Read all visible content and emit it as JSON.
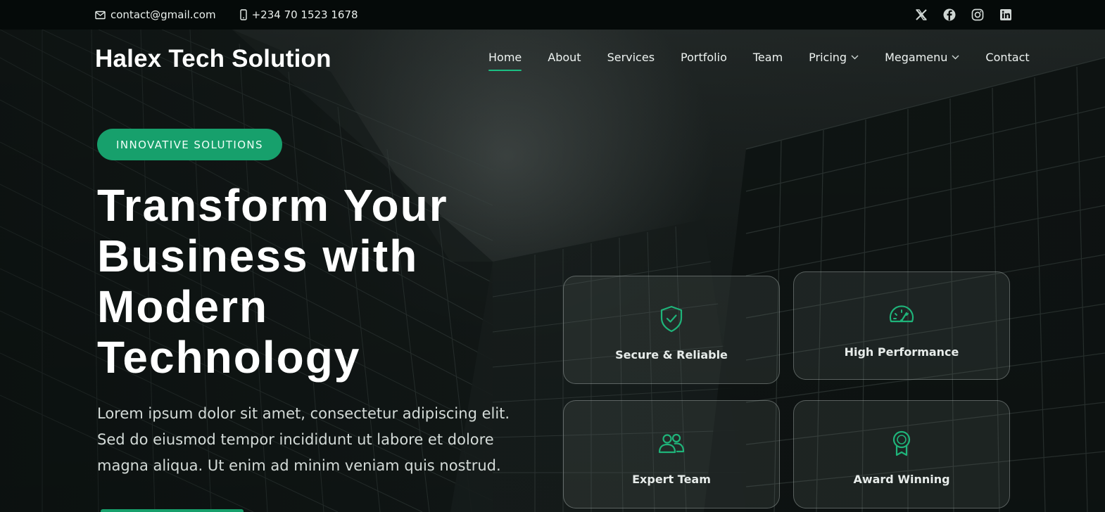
{
  "topbar": {
    "email": "contact@gmail.com",
    "phone": "+234 70 1523 1678",
    "email_icon": "envelope-icon",
    "phone_icon": "mobile-phone-icon",
    "socials": [
      "x-twitter-icon",
      "facebook-icon",
      "instagram-icon",
      "linkedin-icon"
    ]
  },
  "header": {
    "brand": "Halex Tech Solution",
    "nav": [
      {
        "label": "Home",
        "active": true
      },
      {
        "label": "About"
      },
      {
        "label": "Services"
      },
      {
        "label": "Portfolio"
      },
      {
        "label": "Team"
      },
      {
        "label": "Pricing",
        "dropdown": true
      },
      {
        "label": "Megamenu",
        "dropdown": true
      },
      {
        "label": "Contact"
      }
    ]
  },
  "hero": {
    "badge": "INNOVATIVE SOLUTIONS",
    "headline_lines": [
      "Transform Your",
      "Business with",
      "Modern",
      "Technology"
    ],
    "lead": "Lorem ipsum dolor sit amet, consectetur adipiscing elit. Sed do eiusmod tempor incididunt ut labore et dolore magna aliqua. Ut enim ad minim veniam quis nostrud."
  },
  "features": [
    {
      "title": "Secure & Reliable",
      "icon": "shield-check-icon"
    },
    {
      "title": "High Performance",
      "icon": "speedometer-icon"
    },
    {
      "title": "Expert Team",
      "icon": "people-icon"
    },
    {
      "title": "Award Winning",
      "icon": "award-ribbon-icon"
    }
  ],
  "colors": {
    "accent": "#17a06c",
    "topbar_bg": "#050a09"
  }
}
